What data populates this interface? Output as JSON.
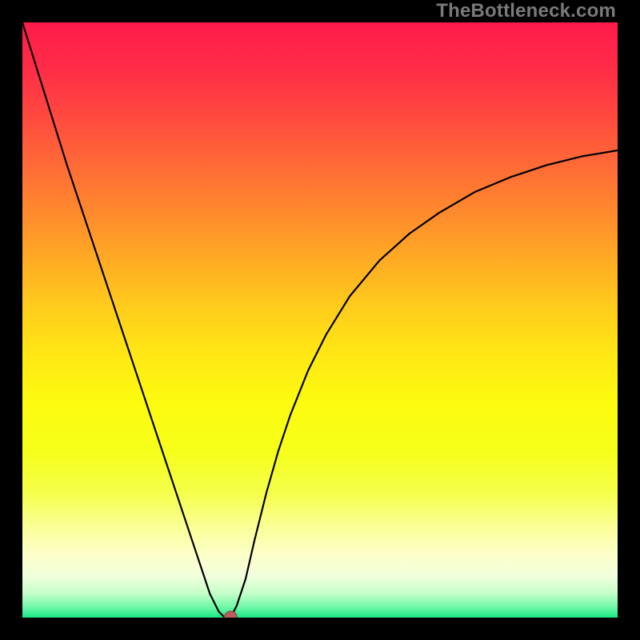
{
  "watermark": "TheBottleneck.com",
  "colors": {
    "frame": "#000000",
    "watermark": "#7a7a7a",
    "curve": "#000000",
    "marker_fill": "#bb5e5e",
    "marker_stroke": "#8f3e3e",
    "gradient_stops": [
      {
        "offset": 0.0,
        "color": "#ff1a4b"
      },
      {
        "offset": 0.08,
        "color": "#ff2d47"
      },
      {
        "offset": 0.16,
        "color": "#ff4a3f"
      },
      {
        "offset": 0.24,
        "color": "#ff6a36"
      },
      {
        "offset": 0.32,
        "color": "#ff8a2d"
      },
      {
        "offset": 0.4,
        "color": "#ffab24"
      },
      {
        "offset": 0.48,
        "color": "#ffcd1c"
      },
      {
        "offset": 0.56,
        "color": "#ffe814"
      },
      {
        "offset": 0.64,
        "color": "#fcfb10"
      },
      {
        "offset": 0.72,
        "color": "#f6ff1a"
      },
      {
        "offset": 0.79,
        "color": "#f5ff4a"
      },
      {
        "offset": 0.847,
        "color": "#faff96"
      },
      {
        "offset": 0.894,
        "color": "#fdffc8"
      },
      {
        "offset": 0.93,
        "color": "#f1ffdd"
      },
      {
        "offset": 0.96,
        "color": "#c4ffc9"
      },
      {
        "offset": 0.984,
        "color": "#68f7a3"
      },
      {
        "offset": 1.0,
        "color": "#17e886"
      }
    ]
  },
  "chart_data": {
    "type": "line",
    "title": "",
    "xlabel": "",
    "ylabel": "",
    "xlim": [
      0,
      100
    ],
    "ylim": [
      0,
      100
    ],
    "series": [
      {
        "name": "bottleneck-curve",
        "x": [
          0.0,
          2.5,
          5.0,
          7.5,
          10.0,
          12.5,
          15.0,
          17.5,
          20.0,
          22.5,
          25.0,
          27.5,
          30.0,
          31.5,
          33.0,
          34.0,
          35.0,
          36.0,
          37.5,
          39.0,
          41.0,
          43.0,
          45.0,
          48.0,
          51.0,
          55.0,
          60.0,
          65.0,
          70.0,
          76.0,
          82.0,
          88.0,
          94.0,
          100.0
        ],
        "y": [
          100.0,
          92.0,
          84.0,
          76.0,
          68.5,
          61.0,
          53.5,
          46.0,
          38.5,
          31.0,
          23.5,
          16.0,
          8.5,
          4.0,
          1.0,
          0.0,
          0.0,
          2.0,
          6.5,
          13.0,
          21.0,
          28.0,
          34.0,
          41.5,
          47.5,
          54.0,
          60.0,
          64.5,
          68.0,
          71.5,
          74.0,
          76.0,
          77.5,
          78.5
        ]
      }
    ],
    "markers": [
      {
        "name": "optimal-point",
        "x": 35.0,
        "y": 0.0
      }
    ],
    "gradient_axis": "y",
    "grid": false,
    "legend": false
  }
}
